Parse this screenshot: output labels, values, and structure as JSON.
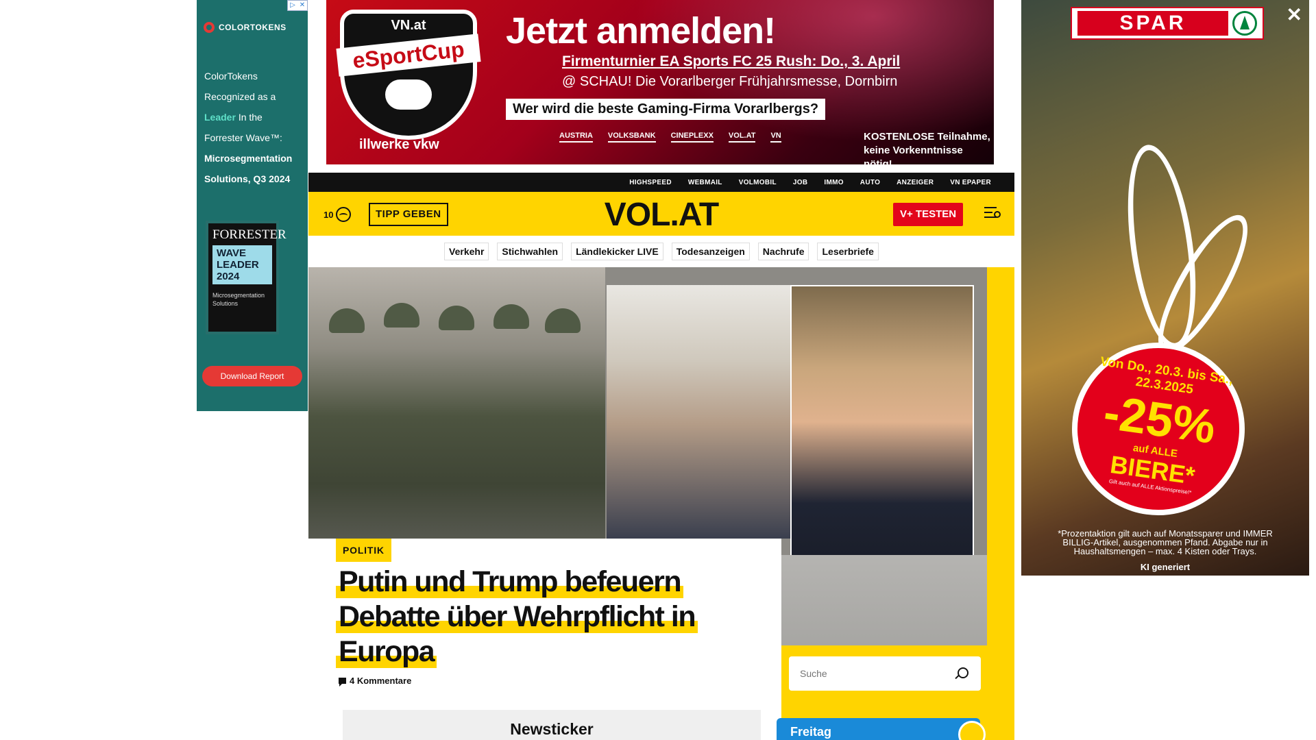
{
  "ad_left": {
    "brand": "COLORTOKENS",
    "line1": "ColorTokens",
    "line2": "Recognized as a",
    "highlight": "Leader",
    "line3": "In the",
    "line4": "Forrester Wave™:",
    "line5": "Microsegmentation",
    "line6": "Solutions, Q3 2024",
    "forrester_name": "FORRESTER",
    "badge_line1": "WAVE",
    "badge_line2": "LEADER 2024",
    "badge_sub": "Microsegmentation Solutions",
    "cta": "Download Report"
  },
  "ad_top": {
    "shield_brand": "VN.at",
    "shield_title": "eSportCup",
    "sponsor": "illwerke vkw",
    "headline": "Jetzt anmelden!",
    "sub1": "Firmenturnier EA Sports FC 25 Rush: Do., 3. April",
    "sub2": "@ SCHAU! Die Vorarlberger Frühjahrsmesse, Dornbirn",
    "question": "Wer wird die beste Gaming-Firma Vorarlbergs?",
    "logos": [
      "AUSTRIA",
      "VOLKSBANK",
      "CINEPLEXX",
      "VOL.AT",
      "VN"
    ],
    "free_line1": "KOSTENLOSE Teilnahme,",
    "free_line2": "keine Vorkenntnisse nötig!"
  },
  "ad_right": {
    "brand": "SPAR",
    "close": "✕",
    "dates": "Von Do., 20.3. bis Sa., 22.3.2025",
    "percent": "-25%",
    "auf": "auf ALLE",
    "biere": "BIERE*",
    "fine": "Gilt auch auf ALLE Aktionspreise!*",
    "disclaimer": "*Prozentaktion gilt auch auf Monatssparer und IMMER BILLIG-Artikel, ausgenommen Pfand. Abgabe nur in Haushaltsmengen – max. 4 Kisten oder Trays.",
    "ki": "KI generiert"
  },
  "topnav": [
    "HIGHSPEED",
    "WEBMAIL",
    "VOLMOBIL",
    "JOB",
    "IMMO",
    "AUTO",
    "ANZEIGER",
    "VN EPAPER"
  ],
  "header": {
    "temperature": "10",
    "tipp": "TIPP GEBEN",
    "logo": "VOL.AT",
    "vplus": "V+ TESTEN"
  },
  "subnav": [
    "Verkehr",
    "Stichwahlen",
    "Ländlekicker LIVE",
    "Todesanzeigen",
    "Nachrufe",
    "Leserbriefe"
  ],
  "article": {
    "category": "POLITIK",
    "headline": "Putin und Trump befeuern Debatte über Wehrpflicht in Europa",
    "comments": "4 Kommentare",
    "newsticker": "Newsticker"
  },
  "search": {
    "placeholder": "Suche"
  },
  "weather_widget": {
    "day": "Freitag"
  },
  "colors": {
    "brand_yellow": "#ffd400",
    "vplus_red": "#e3051b",
    "spar_red": "#d7001d",
    "colortokens_teal": "#1c6f6b"
  }
}
